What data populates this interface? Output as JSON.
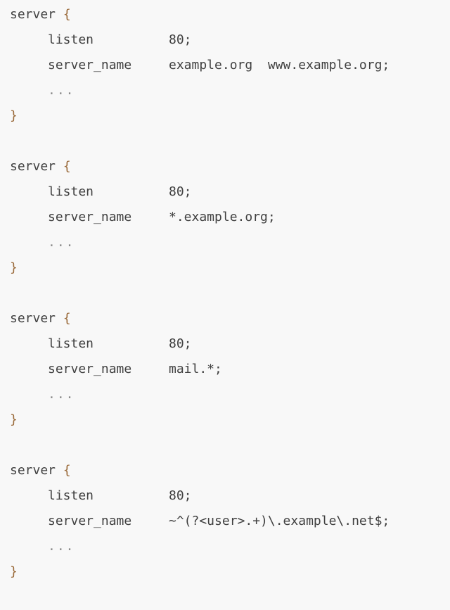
{
  "blocks": [
    {
      "keyword": "server",
      "open": "{",
      "listen_directive": "listen",
      "listen_value": "80;",
      "server_name_directive": "server_name",
      "server_name_value": "example.org  www.example.org;",
      "ellipsis": "...",
      "close": "}"
    },
    {
      "keyword": "server",
      "open": "{",
      "listen_directive": "listen",
      "listen_value": "80;",
      "server_name_directive": "server_name",
      "server_name_value": "*.example.org;",
      "ellipsis": "...",
      "close": "}"
    },
    {
      "keyword": "server",
      "open": "{",
      "listen_directive": "listen",
      "listen_value": "80;",
      "server_name_directive": "server_name",
      "server_name_value": "mail.*;",
      "ellipsis": "...",
      "close": "}"
    },
    {
      "keyword": "server",
      "open": "{",
      "listen_directive": "listen",
      "listen_value": "80;",
      "server_name_directive": "server_name",
      "server_name_value": "~^(?<user>.+)\\.example\\.net$;",
      "ellipsis": "...",
      "close": "}"
    }
  ]
}
